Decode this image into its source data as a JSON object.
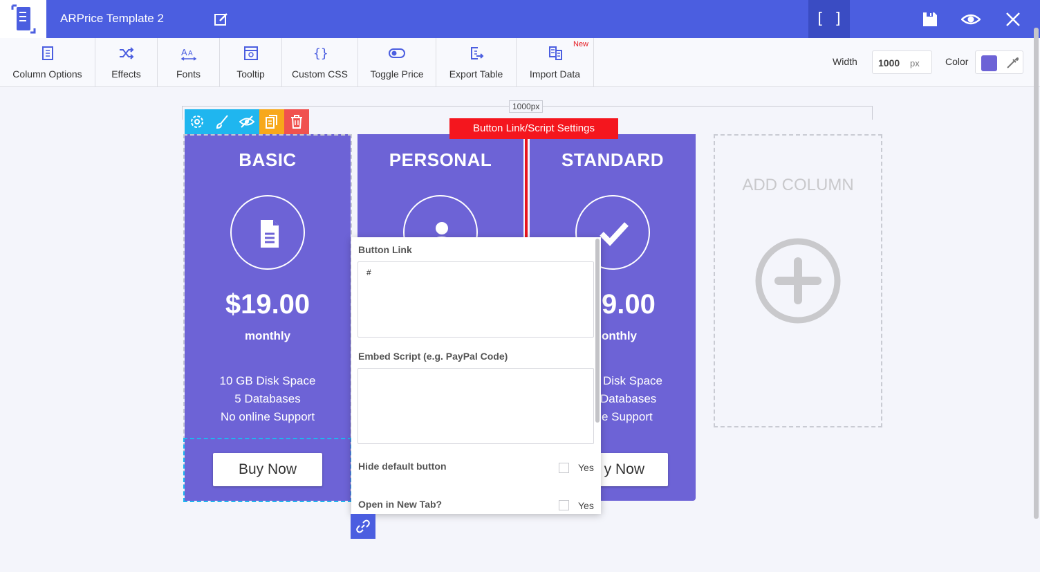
{
  "app": {
    "title": "ARPrice Template 2",
    "bracket_label": "[ ]"
  },
  "toolbar": {
    "items": [
      {
        "label": "Column Options",
        "icon": "column-options-icon"
      },
      {
        "label": "Effects",
        "icon": "shuffle-icon"
      },
      {
        "label": "Fonts",
        "icon": "fonts-icon"
      },
      {
        "label": "Tooltip",
        "icon": "tooltip-icon"
      },
      {
        "label": "Custom CSS",
        "icon": "braces-icon"
      },
      {
        "label": "Toggle Price",
        "icon": "toggle-icon"
      },
      {
        "label": "Export Table",
        "icon": "export-icon"
      },
      {
        "label": "Import Data",
        "icon": "import-icon"
      }
    ],
    "new_badge": "New",
    "width_label": "Width",
    "width_value": "1000",
    "width_unit": "px",
    "color_label": "Color",
    "color_value": "#6d63d6"
  },
  "canvas": {
    "ruler_label": "1000px",
    "tooltip": "Button Link/Script Settings"
  },
  "columns": [
    {
      "title": "BASIC",
      "icon": "document-icon",
      "price": "$19.00",
      "period": "monthly",
      "features": [
        "10 GB Disk Space",
        "5 Databases",
        "No online Support"
      ],
      "button": "Buy Now"
    },
    {
      "title": "PERSONAL",
      "icon": "user-icon"
    },
    {
      "title": "STANDARD",
      "icon": "check-icon",
      "price_partial": "9.00",
      "period_partial": "onthly",
      "features_partial": [
        "Disk Space",
        "Databases",
        "e Support"
      ],
      "button_partial": "y Now"
    }
  ],
  "add_column": {
    "label": "ADD COLUMN"
  },
  "popup": {
    "button_link_label": "Button Link",
    "button_link_value": "#",
    "embed_label": "Embed Script (e.g. PayPal Code)",
    "embed_value": "",
    "hide_default_label": "Hide default button",
    "hide_default_yes": "Yes",
    "hide_default_checked": false,
    "new_tab_label": "Open in New Tab?",
    "new_tab_yes": "Yes",
    "new_tab_checked": false
  },
  "colors": {
    "brand": "#4b5ee0",
    "column": "#6d63d6",
    "tooltip": "#f4161e",
    "settings": "#1fb6ef",
    "copy": "#f7a81b",
    "delete": "#f0524f"
  }
}
